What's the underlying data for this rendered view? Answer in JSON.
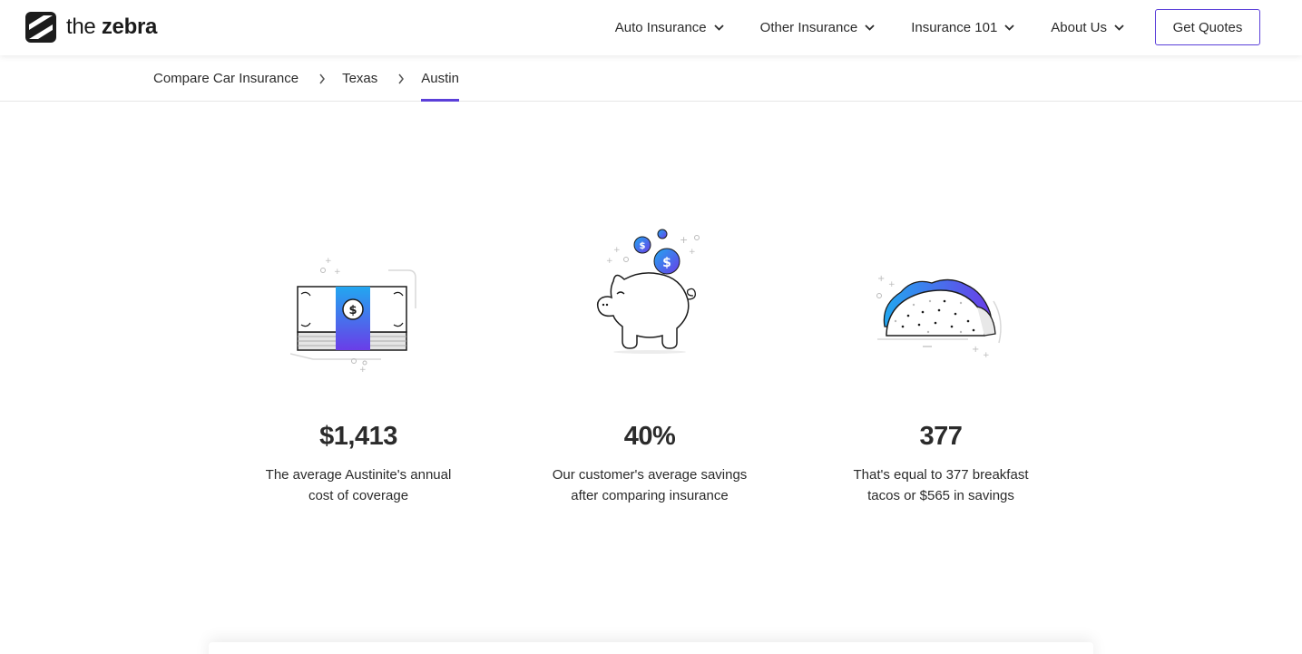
{
  "brand": {
    "logo_light": "the",
    "logo_bold": "zebra",
    "accent": "#5b3fd9"
  },
  "nav": {
    "items": [
      {
        "label": "Auto Insurance"
      },
      {
        "label": "Other Insurance"
      },
      {
        "label": "Insurance 101"
      },
      {
        "label": "About Us"
      }
    ],
    "cta_label": "Get Quotes"
  },
  "breadcrumb": {
    "items": [
      {
        "label": "Compare Car Insurance"
      },
      {
        "label": "Texas"
      },
      {
        "label": "Austin"
      }
    ]
  },
  "stats": [
    {
      "icon": "money-stack-icon",
      "value": "$1,413",
      "description": "The average Austinite's annual cost of coverage"
    },
    {
      "icon": "piggy-bank-icon",
      "value": "40%",
      "description": "Our customer's average savings after comparing insurance"
    },
    {
      "icon": "taco-icon",
      "value": "377",
      "description": "That's equal to 377 breakfast tacos or $565 in savings"
    }
  ]
}
